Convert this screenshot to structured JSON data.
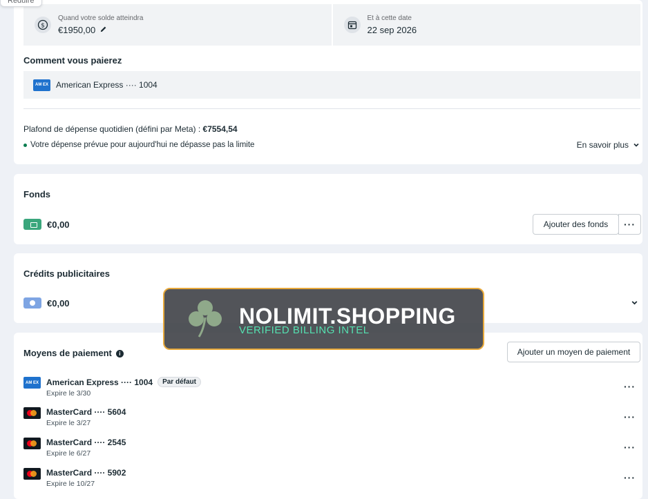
{
  "tooltip": "Réduire",
  "balance": {
    "threshold_label": "Quand votre solde atteindra",
    "threshold_value": "€1950,00",
    "date_label": "Et à cette date",
    "date_value": "22 sep 2026"
  },
  "how_to_pay": {
    "title": "Comment vous paierez",
    "card": "American Express ···· 1004",
    "limit_prefix": "Plafond de dépense quotidien (défini par Meta) : ",
    "limit_value": "€7554,54",
    "note": "Votre dépense prévue pour aujourd'hui ne dépasse pas la limite",
    "learn_more": "En savoir plus"
  },
  "funds": {
    "title": "Fonds",
    "amount": "€0,00",
    "add_button": "Ajouter des fonds"
  },
  "ad_credits": {
    "title": "Crédits publicitaires",
    "amount": "€0,00"
  },
  "payment_methods": {
    "title": "Moyens de paiement",
    "add_button": "Ajouter un moyen de paiement",
    "default_badge": "Par défaut",
    "items": [
      {
        "name": "American Express ···· 1004",
        "expiry": "Expire le 3/30",
        "brand": "amex"
      },
      {
        "name": "MasterCard ···· 5604",
        "expiry": "Expire le 3/27",
        "brand": "mastercard"
      },
      {
        "name": "MasterCard ···· 2545",
        "expiry": "Expire le 6/27",
        "brand": "mastercard"
      },
      {
        "name": "MasterCard ···· 5902",
        "expiry": "Expire le 10/27",
        "brand": "mastercard"
      }
    ]
  },
  "watermark": {
    "title": "NOLIMIT.SHOPPING",
    "subtitle": "VERIFIED BILLING INTEL"
  },
  "icons": {
    "amex_logo_text": "AM EX"
  }
}
